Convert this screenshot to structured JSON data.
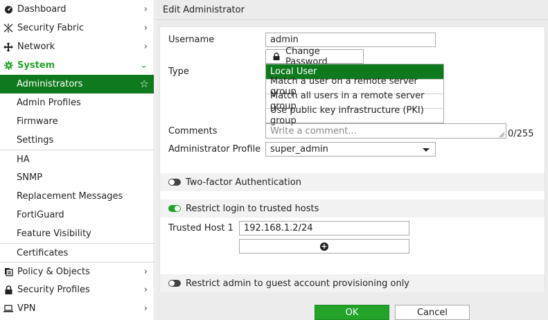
{
  "sidebar": {
    "items": [
      {
        "label": "Dashboard",
        "icon": "dashboard-icon"
      },
      {
        "label": "Security Fabric",
        "icon": "security-fabric-icon"
      },
      {
        "label": "Network",
        "icon": "network-icon"
      },
      {
        "label": "System",
        "icon": "gear-icon"
      },
      {
        "label": "Administrators"
      },
      {
        "label": "Admin Profiles"
      },
      {
        "label": "Firmware"
      },
      {
        "label": "Settings"
      },
      {
        "label": "HA"
      },
      {
        "label": "SNMP"
      },
      {
        "label": "Replacement Messages"
      },
      {
        "label": "FortiGuard"
      },
      {
        "label": "Feature Visibility"
      },
      {
        "label": "Certificates"
      },
      {
        "label": "Policy & Objects",
        "icon": "policy-icon"
      },
      {
        "label": "Security Profiles",
        "icon": "lock-icon"
      },
      {
        "label": "VPN",
        "icon": "laptop-icon"
      }
    ]
  },
  "header": {
    "title": "Edit Administrator"
  },
  "form": {
    "username_label": "Username",
    "username_value": "admin",
    "change_password_label": "Change Password",
    "type_label": "Type",
    "type_options": [
      "Local User",
      "Match a user on a remote server group",
      "Match all users in a remote server group",
      "Use public key infrastructure (PKI) group"
    ],
    "comments_label": "Comments",
    "comments_placeholder": "Write a comment...",
    "comments_counter": "0/255",
    "profile_label": "Administrator Profile",
    "profile_value": "super_admin",
    "two_factor_label": "Two-factor Authentication",
    "restrict_login_label": "Restrict login to trusted hosts",
    "trusted_host_label": "Trusted Host 1",
    "trusted_host_value": "192.168.1.2/24",
    "restrict_guest_label": "Restrict admin to guest account provisioning only"
  },
  "footer": {
    "ok_label": "OK",
    "cancel_label": "Cancel"
  },
  "colors": {
    "accent_green": "#23a32a",
    "selected_green": "#0f7a1d"
  }
}
